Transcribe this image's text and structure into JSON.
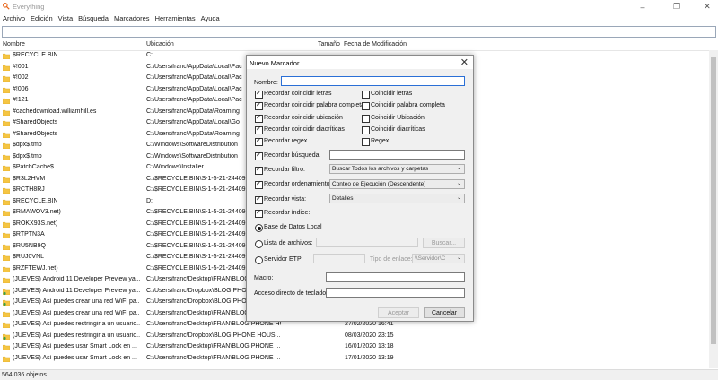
{
  "window": {
    "title": "Everything"
  },
  "menu": [
    "Archivo",
    "Edición",
    "Vista",
    "Búsqueda",
    "Marcadores",
    "Herramientas",
    "Ayuda"
  ],
  "columns": {
    "name": "Nombre",
    "location": "Ubicación",
    "size": "Tamaño",
    "modified": "Fecha de Modificación"
  },
  "rows": [
    {
      "name": "$RECYCLE.BIN",
      "location": "C:",
      "date": "",
      "icon": "folder"
    },
    {
      "name": "#!001",
      "location": "C:\\Users\\franc\\AppData\\Local\\Pac",
      "date": "",
      "icon": "folder"
    },
    {
      "name": "#!002",
      "location": "C:\\Users\\franc\\AppData\\Local\\Pac",
      "date": "",
      "icon": "folder"
    },
    {
      "name": "#!006",
      "location": "C:\\Users\\franc\\AppData\\Local\\Pac",
      "date": "",
      "icon": "folder"
    },
    {
      "name": "#!121",
      "location": "C:\\Users\\franc\\AppData\\Local\\Pac",
      "date": "",
      "icon": "folder"
    },
    {
      "name": "#cachedownload.williamhill.es",
      "location": "C:\\Users\\franc\\AppData\\Roaming",
      "date": "",
      "icon": "folder"
    },
    {
      "name": "#SharedObjects",
      "location": "C:\\Users\\franc\\AppData\\Local\\Go",
      "date": "",
      "icon": "folder"
    },
    {
      "name": "#SharedObjects",
      "location": "C:\\Users\\franc\\AppData\\Roaming",
      "date": "",
      "icon": "folder"
    },
    {
      "name": "$dpx$.tmp",
      "location": "C:\\Windows\\SoftwareDistribution",
      "date": "",
      "icon": "folder"
    },
    {
      "name": "$dpx$.tmp",
      "location": "C:\\Windows\\SoftwareDistribution",
      "date": "",
      "icon": "folder"
    },
    {
      "name": "$PatchCache$",
      "location": "C:\\Windows\\Installer",
      "date": "",
      "icon": "folder"
    },
    {
      "name": "$R3L2HVM",
      "location": "C:\\$RECYCLE.BIN\\S-1-5-21-24409",
      "date": "",
      "icon": "folder"
    },
    {
      "name": "$RCTH8RJ",
      "location": "C:\\$RECYCLE.BIN\\S-1-5-21-24409",
      "date": "",
      "icon": "folder"
    },
    {
      "name": "$RECYCLE.BIN",
      "location": "D:",
      "date": "",
      "icon": "folder"
    },
    {
      "name": "$RMAWOV3.net)",
      "location": "C:\\$RECYCLE.BIN\\S-1-5-21-24409",
      "date": "",
      "icon": "folder"
    },
    {
      "name": "$ROKX93S.net)",
      "location": "C:\\$RECYCLE.BIN\\S-1-5-21-24409",
      "date": "",
      "icon": "folder"
    },
    {
      "name": "$RTPTN3A",
      "location": "C:\\$RECYCLE.BIN\\S-1-5-21-24409",
      "date": "",
      "icon": "folder"
    },
    {
      "name": "$RU5NB9Q",
      "location": "C:\\$RECYCLE.BIN\\S-1-5-21-24409",
      "date": "",
      "icon": "folder"
    },
    {
      "name": "$RUJ0VNL",
      "location": "C:\\$RECYCLE.BIN\\S-1-5-21-24409",
      "date": "",
      "icon": "folder"
    },
    {
      "name": "$RZFTEWJ.net)",
      "location": "C:\\$RECYCLE.BIN\\S-1-5-21-24409",
      "date": "",
      "icon": "folder"
    },
    {
      "name": "(JUEVES) Android 11 Developer Preview ya...",
      "location": "C:\\Users\\franc\\Desktop\\FRAN\\BLOG",
      "date": "",
      "icon": "folder"
    },
    {
      "name": "(JUEVES) Android 11 Developer Preview ya...",
      "location": "C:\\Users\\franc\\Dropbox\\BLOG PHO",
      "date": "",
      "icon": "folder-sync"
    },
    {
      "name": "(JUEVES) Así puedes crear una red WiFi pa...",
      "location": "C:\\Users\\franc\\Dropbox\\BLOG PHO",
      "date": "",
      "icon": "folder-sync"
    },
    {
      "name": "(JUEVES) Así puedes crear una red WiFi pa...",
      "location": "C:\\Users\\franc\\Desktop\\FRAN\\BLOG",
      "date": "",
      "icon": "folder"
    },
    {
      "name": "(JUEVES) Así puedes restringir a un usuario...",
      "location": "C:\\Users\\franc\\Desktop\\FRAN\\BLOG PHONE HOUS...",
      "date": "27/02/2020 16:41",
      "icon": "folder"
    },
    {
      "name": "(JUEVES) Así puedes restringir a un usuario...",
      "location": "C:\\Users\\franc\\Dropbox\\BLOG PHONE HOUS...",
      "date": "08/03/2020 23:15",
      "icon": "folder-sync"
    },
    {
      "name": "(JUEVES) Así puedes usar Smart Lock en ...",
      "location": "C:\\Users\\franc\\Desktop\\FRAN\\BLOG PHONE ...",
      "date": "16/01/2020 13:18",
      "icon": "folder"
    },
    {
      "name": "(JUEVES) Así puedes usar Smart Lock en ...",
      "location": "C:\\Users\\franc\\Desktop\\FRAN\\BLOG PHONE ...",
      "date": "17/01/2020 13:19",
      "icon": "folder"
    }
  ],
  "status": {
    "count": "564.036 objetos"
  },
  "dialog": {
    "title": "Nuevo Marcador",
    "name_label": "Nombre:",
    "name_value": "",
    "remember_left": [
      {
        "label": "Recordar coincidir letras",
        "checked": true
      },
      {
        "label": "Recordar coincidir palabra completa",
        "checked": true
      },
      {
        "label": "Recordar coincidir ubicación",
        "checked": true
      },
      {
        "label": "Recordar coincidir diacríticas",
        "checked": true
      },
      {
        "label": "Recordar regex",
        "checked": true
      }
    ],
    "match_right": [
      {
        "label": "Coincidir letras",
        "checked": false
      },
      {
        "label": "Coincidir palabra completa",
        "checked": false
      },
      {
        "label": "Coincidir Ubicación",
        "checked": false
      },
      {
        "label": "Coincidir diacríticas",
        "checked": false
      },
      {
        "label": "Regex",
        "checked": false
      }
    ],
    "remember_search": "Recordar búsqueda:",
    "remember_filter": "Recordar filtro:",
    "filter_value": "Buscar Todos los archivos y carpetas",
    "remember_sort": "Recordar ordenamiento",
    "sort_value": "Conteo de Ejecución (Descendente)",
    "remember_view": "Recordar vista:",
    "view_value": "Detalles",
    "remember_index": "Recordar índice:",
    "radio_local": "Base de Datos Local",
    "radio_files": "Lista de archivos:",
    "browse_label": "Buscar...",
    "radio_ftp": "Servidor ETP:",
    "link_type_label": "Tipo de enlace:",
    "link_type_value": "\\\\Servidor\\C",
    "macro_label": "Macro:",
    "shortcut_label": "Acceso directo de teclado:",
    "accept_label": "Aceptar",
    "cancel_label": "Cancelar"
  }
}
